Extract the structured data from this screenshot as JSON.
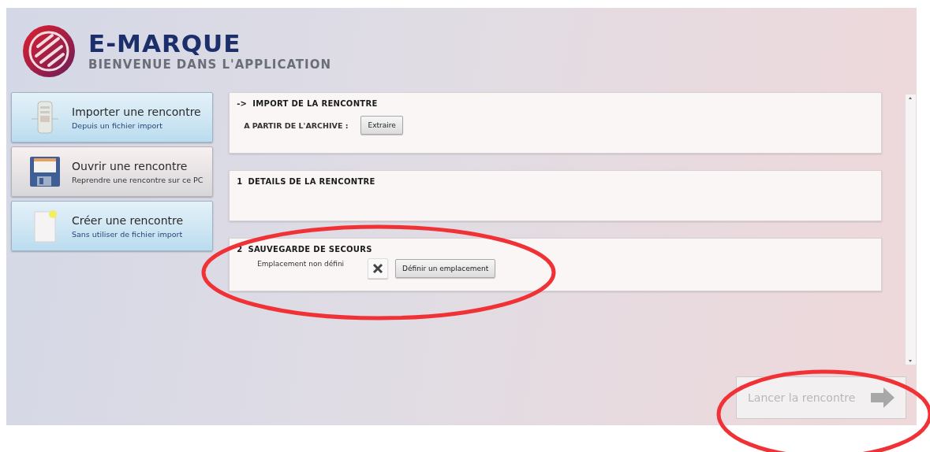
{
  "header": {
    "title": "E-MARQUE",
    "subtitle": "BIENVENUE DANS L'APPLICATION"
  },
  "sidebar": {
    "items": [
      {
        "kind": "import",
        "title": "Importer une rencontre",
        "subtitle": "Depuis un fichier import",
        "hovered": false
      },
      {
        "kind": "open",
        "title": "Ouvrir une rencontre",
        "subtitle": "Reprendre une rencontre sur ce PC",
        "hovered": true
      },
      {
        "kind": "create",
        "title": "Créer une rencontre",
        "subtitle": "Sans utiliser de fichier import",
        "hovered": false
      }
    ]
  },
  "sections": [
    {
      "kind": "import",
      "number": "->",
      "title": "IMPORT DE LA RENCONTRE",
      "label": "A PARTIR DE L'ARCHIVE :",
      "button": "Extraire"
    },
    {
      "kind": "details",
      "number": "1",
      "title": "DETAILS DE LA RENCONTRE"
    },
    {
      "kind": "backup",
      "number": "2",
      "title": "SAUVEGARDE DE SECOURS",
      "label": "Emplacement non défini",
      "button": "Définir un emplacement"
    }
  ],
  "launch_button": {
    "label": "Lancer la rencontre",
    "disabled": true
  },
  "annotations": [
    {
      "kind": "ellipse"
    },
    {
      "kind": "ellipse"
    }
  ]
}
